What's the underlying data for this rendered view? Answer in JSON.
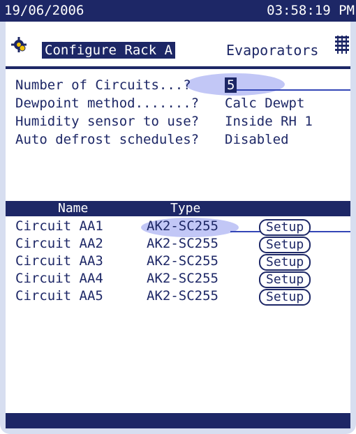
{
  "status_bar": {
    "date": "19/06/2006",
    "time": "03:58:19 PM"
  },
  "header": {
    "title": "Configure Rack A",
    "section": "Evaporators"
  },
  "settings": [
    {
      "label": "Number of Circuits...?",
      "value": "5"
    },
    {
      "label": "Dewpoint method.......?",
      "value": "Calc Dewpt"
    },
    {
      "label": "Humidity sensor to use?",
      "value": "Inside RH 1"
    },
    {
      "label": "Auto defrost schedules?",
      "value": "Disabled"
    }
  ],
  "circuit_table": {
    "columns": [
      "Name",
      "Type"
    ],
    "rows": [
      {
        "name": "Circuit AA1",
        "type": "AK2-SC255",
        "action": "Setup"
      },
      {
        "name": "Circuit AA2",
        "type": "AK2-SC255",
        "action": "Setup"
      },
      {
        "name": "Circuit AA3",
        "type": "AK2-SC255",
        "action": "Setup"
      },
      {
        "name": "Circuit AA4",
        "type": "AK2-SC255",
        "action": "Setup"
      },
      {
        "name": "Circuit AA5",
        "type": "AK2-SC255",
        "action": "Setup"
      }
    ]
  },
  "icons": {
    "header_left": "gear-icon",
    "header_right": "rack-icon"
  },
  "colors": {
    "dark_blue": "#1d2766",
    "highlight": "#8088e8",
    "frame": "#d7def0"
  }
}
